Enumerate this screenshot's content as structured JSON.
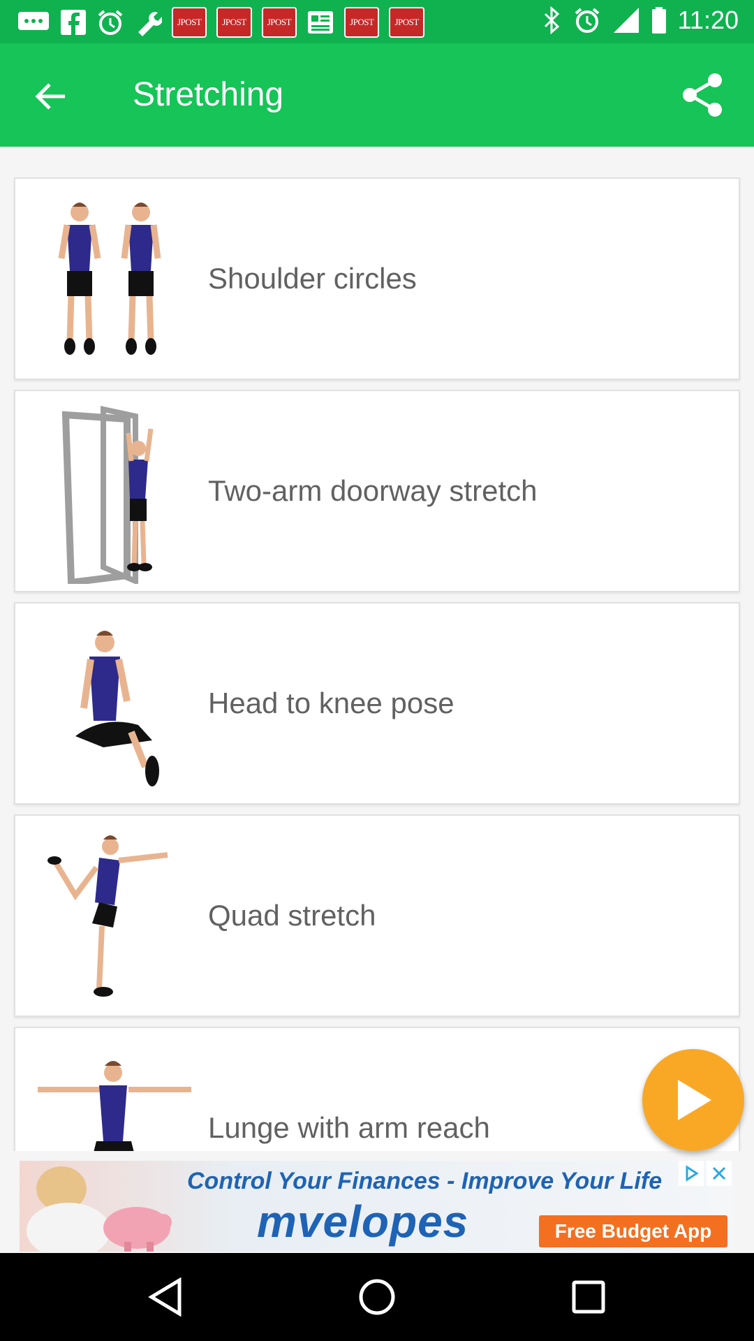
{
  "status_bar": {
    "time": "11:20",
    "notification_badges": [
      "JPOST",
      "JPOST",
      "JPOST",
      "JPOST",
      "JPOST"
    ],
    "icons": [
      "messages-icon",
      "facebook-icon",
      "alarm-icon",
      "wrench-icon",
      "newspaper-icon",
      "bluetooth-icon",
      "alarm-icon",
      "signal-icon"
    ]
  },
  "app_bar": {
    "title": "Stretching",
    "back_icon": "arrow-back-icon",
    "share_icon": "share-icon"
  },
  "exercises": [
    {
      "name": "Shoulder circles",
      "thumb": "two-standing-figures"
    },
    {
      "name": "Two-arm doorway stretch",
      "thumb": "doorway-figure"
    },
    {
      "name": "Head to knee pose",
      "thumb": "seated-figure"
    },
    {
      "name": "Quad stretch",
      "thumb": "balance-figure"
    },
    {
      "name": "Lunge with arm reach",
      "thumb": "arms-out-figure"
    }
  ],
  "play_button": {
    "icon": "play-icon"
  },
  "ad": {
    "headline": "Control Your Finances - Improve Your Life",
    "brand": "mvelopes",
    "cta": "Free Budget App",
    "icons": [
      "adchoices-icon",
      "close-icon"
    ]
  },
  "nav_bar": {
    "icons": [
      "back-triangle-icon",
      "home-circle-icon",
      "recents-square-icon"
    ]
  },
  "colors": {
    "primary": "#16c457",
    "status_bar": "#0fb24f",
    "fab": "#f9a825",
    "ad_accent": "#1e63b5",
    "cta": "#f37021"
  }
}
